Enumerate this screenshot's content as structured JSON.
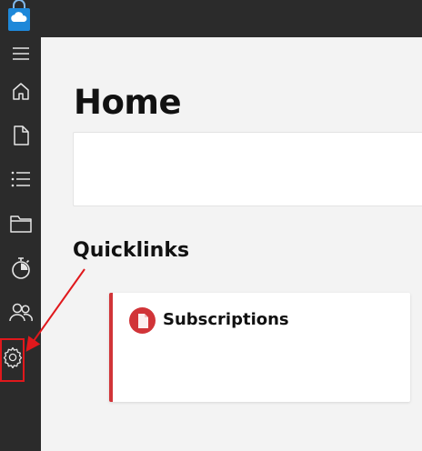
{
  "header": {
    "logo_icon": "shopping-bag-cloud-icon"
  },
  "sidebar": {
    "items": [
      {
        "name": "menu",
        "icon": "hamburger-icon"
      },
      {
        "name": "home",
        "icon": "home-icon"
      },
      {
        "name": "documents",
        "icon": "document-icon"
      },
      {
        "name": "list",
        "icon": "list-icon"
      },
      {
        "name": "folder",
        "icon": "folder-icon"
      },
      {
        "name": "timer",
        "icon": "stopwatch-icon"
      },
      {
        "name": "users",
        "icon": "people-icon"
      },
      {
        "name": "settings",
        "icon": "gear-icon"
      }
    ]
  },
  "main": {
    "title": "Home",
    "quicklinks_title": "Quicklinks",
    "quicklinks": [
      {
        "label": "Subscriptions",
        "icon": "document-icon",
        "accent": "#d13438"
      }
    ]
  },
  "colors": {
    "sidebar_bg": "#2b2b2b",
    "page_bg": "#f3f3f3",
    "accent_red": "#d13438",
    "annotation_red": "#e0181c"
  }
}
